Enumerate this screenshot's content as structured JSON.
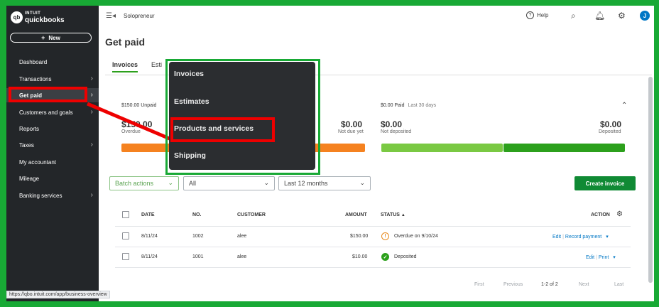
{
  "logo": {
    "mark": "qb",
    "line1": "INTUIT",
    "line2": "quickbooks"
  },
  "sidebar": {
    "new_label": "New",
    "items": [
      {
        "label": "Dashboard",
        "has_chevron": false
      },
      {
        "label": "Transactions",
        "has_chevron": true
      },
      {
        "label": "Get paid",
        "has_chevron": true,
        "active": true
      },
      {
        "label": "Customers and goals",
        "has_chevron": true
      },
      {
        "label": "Reports",
        "has_chevron": false
      },
      {
        "label": "Taxes",
        "has_chevron": true
      },
      {
        "label": "My accountant",
        "has_chevron": false
      },
      {
        "label": "Mileage",
        "has_chevron": false
      },
      {
        "label": "Banking services",
        "has_chevron": true
      }
    ]
  },
  "url_tooltip": "https://qbo.intuit.com/app/business-overview",
  "header": {
    "company": "Solopreneur",
    "help_label": "Help",
    "avatar_initial": "J",
    "page_title": "Get paid"
  },
  "tabs": [
    "Invoices",
    "Esti"
  ],
  "summary": {
    "unpaid_label": "$150.00 Unpaid",
    "overdue_amount": "$150.00",
    "overdue_label": "Overdue",
    "not_due_amount": "$0.00",
    "not_due_label": "Not due yet",
    "paid_label": "$0.00 Paid",
    "paid_period": "Last 30 days",
    "not_deposited_amount": "$0.00",
    "not_deposited_label": "Not deposited",
    "deposited_amount": "$0.00",
    "deposited_label": "Deposited",
    "colors": {
      "overdue": "#f58220",
      "not_due": "#f58220",
      "not_deposited": "#7ac943",
      "deposited": "#2ca01c"
    }
  },
  "filters": {
    "batch_actions": "Batch actions",
    "status_filter": "All",
    "date_filter": "Last 12 months",
    "create_invoice": "Create invoice"
  },
  "table": {
    "columns": {
      "date": "DATE",
      "no": "NO.",
      "customer": "CUSTOMER",
      "amount": "AMOUNT",
      "status": "STATUS",
      "status_sort": "▲",
      "action": "ACTION"
    },
    "rows": [
      {
        "date": "8/11/24",
        "no": "1002",
        "customer": "alee",
        "amount": "$150.00",
        "status": "Overdue on 9/10/24",
        "status_type": "warn",
        "status_glyph": "!",
        "action_primary": "Edit",
        "action_secondary": "Record payment"
      },
      {
        "date": "8/11/24",
        "no": "1001",
        "customer": "alee",
        "amount": "$10.00",
        "status": "Deposited",
        "status_type": "ok",
        "status_glyph": "✓",
        "action_primary": "Edit",
        "action_secondary": "Print"
      }
    ]
  },
  "pagination": {
    "first": "First",
    "previous": "Previous",
    "range": "1-2 of 2",
    "next": "Next",
    "last": "Last"
  },
  "dropdown": {
    "items": [
      "Invoices",
      "Estimates",
      "Products and services",
      "Shipping"
    ],
    "highlighted": "Products and services"
  },
  "annotation_colors": {
    "highlight": "#ee0000",
    "outline": "#18a935"
  }
}
